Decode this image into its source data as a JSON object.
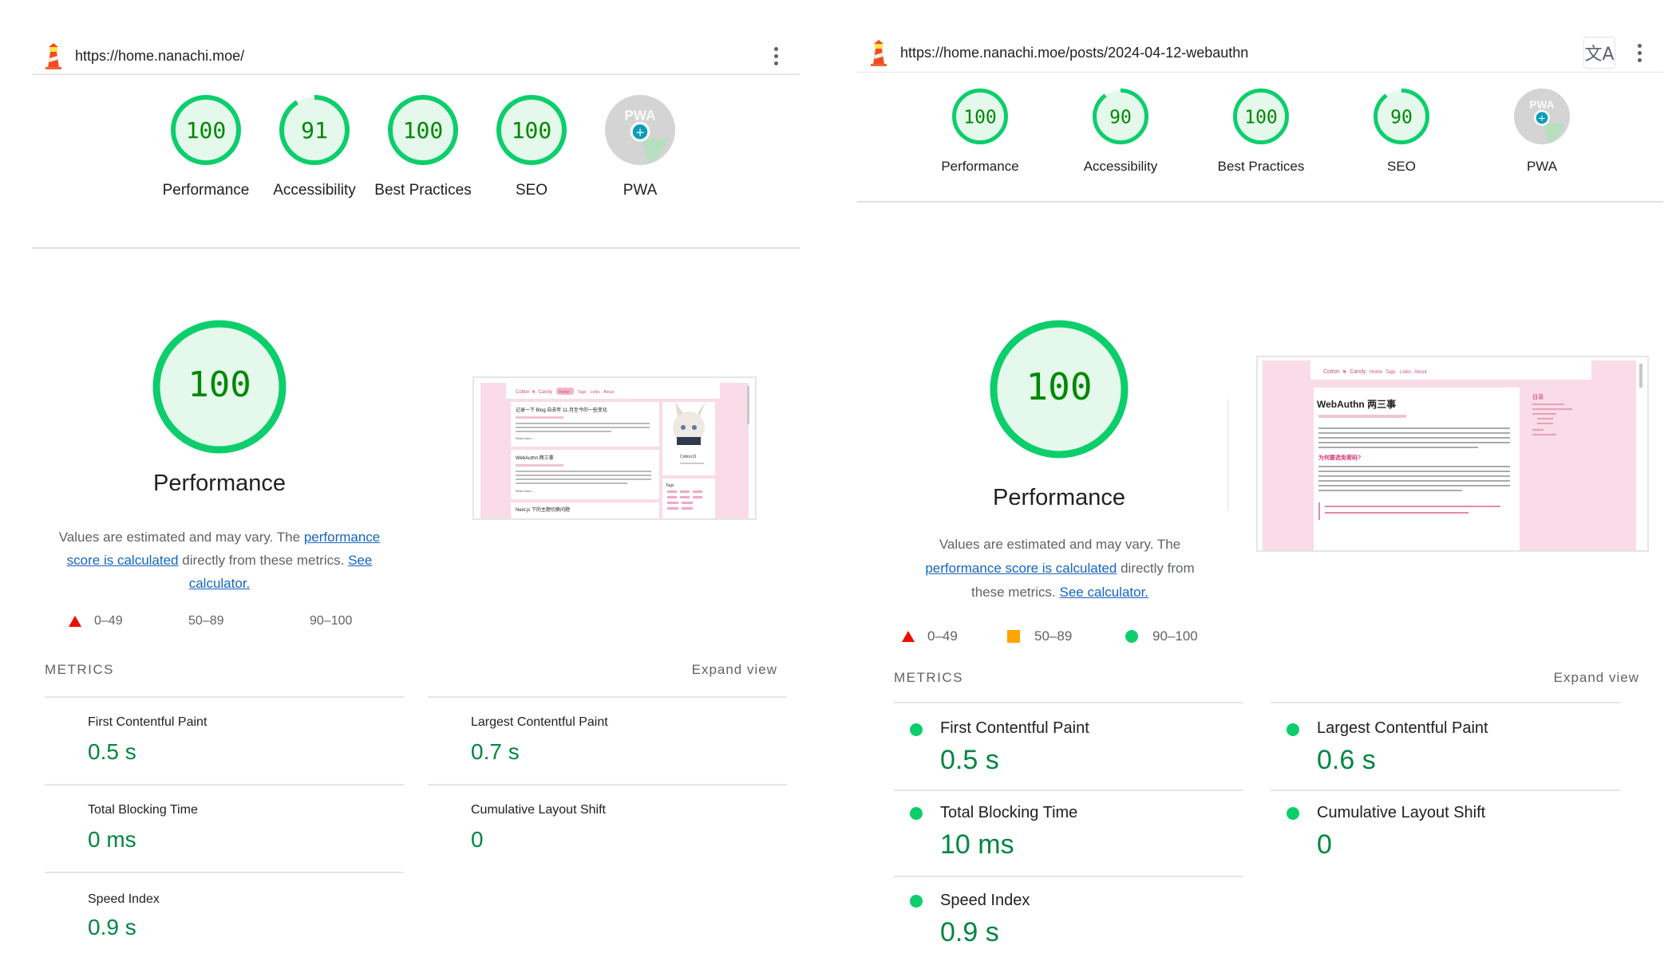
{
  "left": {
    "url": "https://home.nanachi.moe/",
    "categories": [
      {
        "score": "100",
        "label": "Performance",
        "value": 100
      },
      {
        "score": "91",
        "label": "Accessibility",
        "value": 91
      },
      {
        "score": "100",
        "label": "Best Practices",
        "value": 100
      },
      {
        "score": "100",
        "label": "SEO",
        "value": 100
      },
      {
        "score": "",
        "label": "PWA",
        "value": null
      }
    ],
    "performance": {
      "score": "100",
      "title": "Performance",
      "desc_prefix": "Values are estimated and may vary. The ",
      "desc_link1": "performance score is calculated",
      "desc_mid": " directly from these metrics. ",
      "desc_link2": "See calculator."
    },
    "legend": [
      "0–49",
      "50–89",
      "90–100"
    ],
    "metrics_header": "METRICS",
    "expand_view": "Expand view",
    "metrics": [
      {
        "name": "First Contentful Paint",
        "value": "0.5 s"
      },
      {
        "name": "Largest Contentful Paint",
        "value": "0.7 s"
      },
      {
        "name": "Total Blocking Time",
        "value": "0 ms"
      },
      {
        "name": "Cumulative Layout Shift",
        "value": "0"
      },
      {
        "name": "Speed Index",
        "value": "0.9 s"
      }
    ]
  },
  "right": {
    "url": "https://home.nanachi.moe/posts/2024-04-12-webauthn",
    "categories": [
      {
        "score": "100",
        "label": "Performance",
        "value": 100
      },
      {
        "score": "90",
        "label": "Accessibility",
        "value": 90
      },
      {
        "score": "100",
        "label": "Best Practices",
        "value": 100
      },
      {
        "score": "90",
        "label": "SEO",
        "value": 90
      },
      {
        "score": "",
        "label": "PWA",
        "value": null
      }
    ],
    "performance": {
      "score": "100",
      "title": "Performance",
      "desc_prefix": "Values are estimated and may vary. The ",
      "desc_link1": "performance score is calculated",
      "desc_mid": " directly from these metrics. ",
      "desc_link2": "See calculator."
    },
    "legend": [
      "0–49",
      "50–89",
      "90–100"
    ],
    "metrics_header": "METRICS",
    "expand_view": "Expand view",
    "metrics": [
      {
        "name": "First Contentful Paint",
        "value": "0.5 s"
      },
      {
        "name": "Largest Contentful Paint",
        "value": "0.6 s"
      },
      {
        "name": "Total Blocking Time",
        "value": "10 ms"
      },
      {
        "name": "Cumulative Layout Shift",
        "value": "0"
      },
      {
        "name": "Speed Index",
        "value": "0.9 s"
      }
    ]
  },
  "thumbnails": {
    "left": {
      "site_title": "Cotton 🍬 Candy",
      "nav": [
        "Home",
        "Tags",
        "Links",
        "About"
      ],
      "post1_title": "记录一下 Blog 自去年 11 月至今的一些变化",
      "post2_title": "WebAuthn 两三事",
      "post3_title": "Next.js 下的主题切换问题",
      "read_more": "Read more →",
      "sidebar_name": "Cotton13",
      "tags_label": "Tags"
    },
    "right": {
      "site_title": "Cotton 🍬 Candy",
      "nav": [
        "Home",
        "Tags",
        "Links",
        "About"
      ],
      "post_title": "WebAuthn 两三事",
      "toc_label": "目录",
      "heading2": "为何要选免密码?"
    }
  },
  "colors": {
    "pass": "#0cce6b",
    "pass_bg": "#e5f8ec",
    "pass_text": "#008800",
    "average": "#ffa400",
    "fail": "#eb0f00",
    "link": "#1565c0",
    "pwa_gray": "#cccccc"
  }
}
